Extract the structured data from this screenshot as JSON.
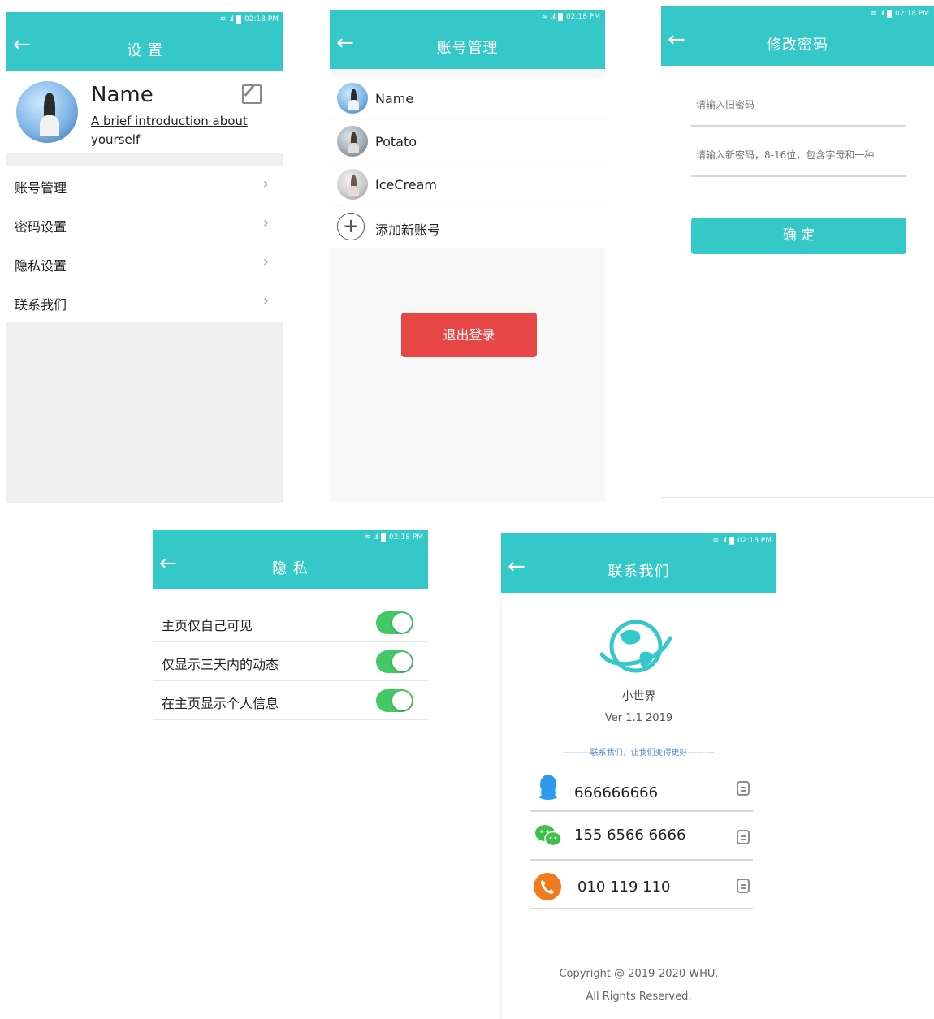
{
  "status_bar": {
    "time": "02:18 PM"
  },
  "settings": {
    "title": "设 置",
    "profile": {
      "name": "Name",
      "intro": "A brief introduction about yourself"
    },
    "menu": [
      {
        "label": "账号管理"
      },
      {
        "label": "密码设置"
      },
      {
        "label": "隐私设置"
      },
      {
        "label": "联系我们"
      }
    ]
  },
  "accounts": {
    "title": "账号管理",
    "items": [
      {
        "name": "Name"
      },
      {
        "name": "Potato"
      },
      {
        "name": "IceCream"
      }
    ],
    "add_label": "添加新账号",
    "logout_label": "退出登录"
  },
  "password": {
    "title": "修改密码",
    "old_placeholder": "请输入旧密码",
    "new_placeholder": "请输入新密码，8-16位，包含字母和一种",
    "confirm_label": "确 定"
  },
  "privacy": {
    "title": "隐 私",
    "options": [
      {
        "label": "主页仅自己可见",
        "enabled": true
      },
      {
        "label": "仅显示三天内的动态",
        "enabled": true
      },
      {
        "label": "在主页显示个人信息",
        "enabled": true
      }
    ]
  },
  "contact": {
    "title": "联系我们",
    "app_name": "小世界",
    "version": "Ver 1.1 2019",
    "slogan": "---------联系我们，让我们变得更好---------",
    "items": [
      {
        "icon": "qq-icon",
        "value": "666666666"
      },
      {
        "icon": "wechat-icon",
        "value": "155 6566 6666"
      },
      {
        "icon": "phone-icon",
        "value": "010 119 110"
      }
    ],
    "copyright": "Copyright @ 2019-2020 WHU.",
    "rights": "All Rights Reserved."
  },
  "colors": {
    "accent": "#34c8c8",
    "logout": "#e84545",
    "toggle_on": "#44c767"
  }
}
